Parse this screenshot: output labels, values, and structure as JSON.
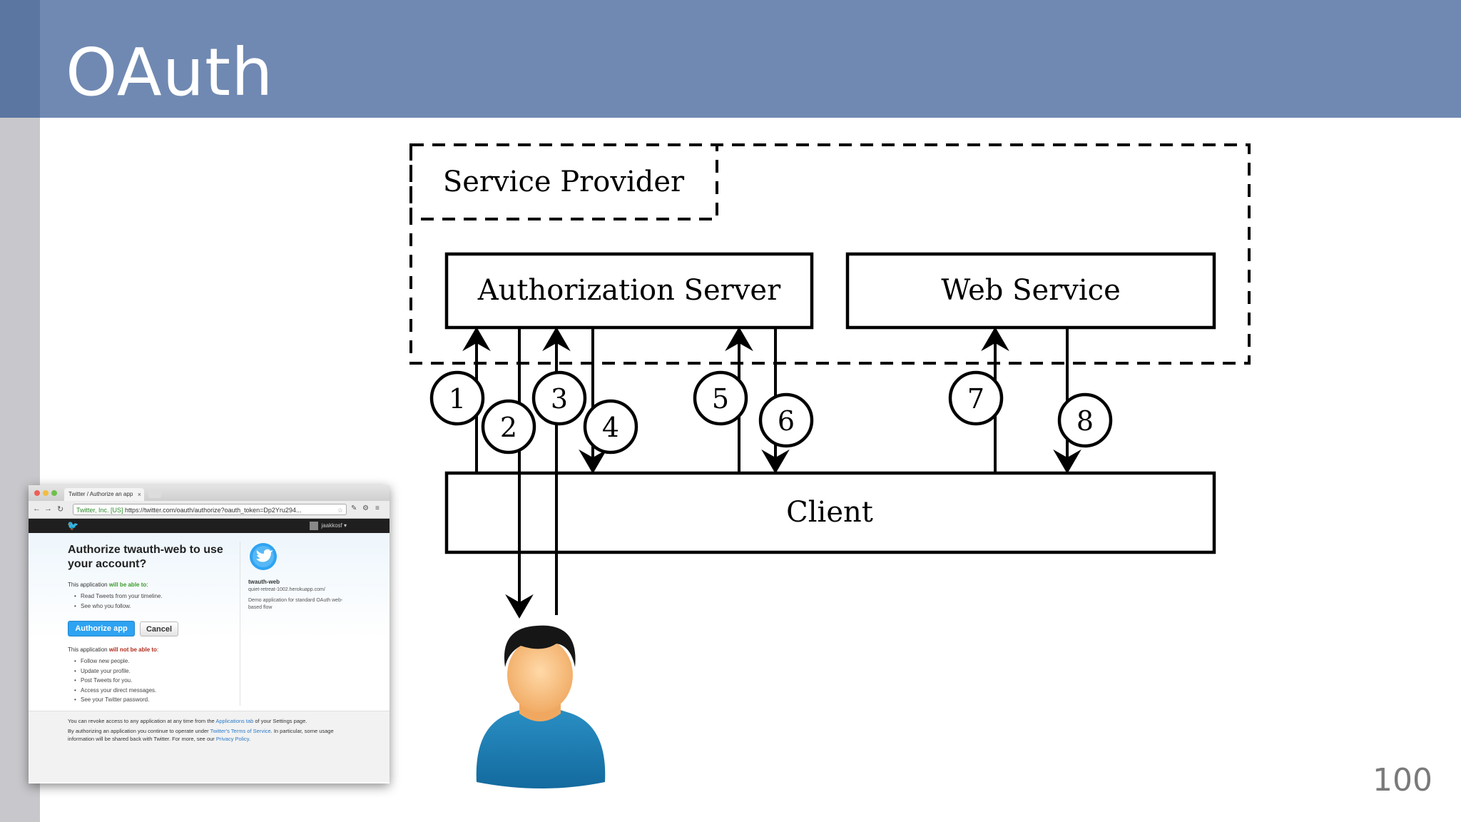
{
  "slide": {
    "title": "OAuth",
    "page_number": "100",
    "colors": {
      "header": "#7089b2",
      "left_bar": "#c8c8cc",
      "left_bar_top": "#5c76a2"
    }
  },
  "diagram": {
    "service_provider_label": "Service Provider",
    "authorization_server_label": "Authorization Server",
    "web_service_label": "Web Service",
    "client_label": "Client",
    "steps": [
      "1",
      "2",
      "3",
      "4",
      "5",
      "6",
      "7",
      "8"
    ]
  },
  "browser": {
    "tab_title": "Twitter / Authorize an app",
    "tab_close": "×",
    "secure_label": "Twitter, Inc. [US]",
    "url": "https://twitter.com/oauth/authorize?oauth_token=Dp2Yru294...",
    "username": "jaakkosf ▾",
    "heading": "Authorize twauth-web to use your account?",
    "able_intro_prefix": "This application ",
    "able_intro_emph": "will be able to",
    "able_intro_suffix": ":",
    "able_items": [
      "Read Tweets from your timeline.",
      "See who you follow."
    ],
    "authorize_button": "Authorize app",
    "cancel_button": "Cancel",
    "not_able_intro_prefix": "This application ",
    "not_able_intro_emph": "will not be able to",
    "not_able_intro_suffix": ":",
    "not_able_items": [
      "Follow new people.",
      "Update your profile.",
      "Post Tweets for you.",
      "Access your direct messages.",
      "See your Twitter password."
    ],
    "app_name": "twauth-web",
    "app_url": "quiet-retreat-1002.herokuapp.com/",
    "app_desc": "Demo application for standard OAuth web-based flow",
    "footer_1a": "You can revoke access to any application at any time from the ",
    "footer_1_link": "Applications tab",
    "footer_1b": " of your Settings page.",
    "footer_2a": "By authorizing an application you continue to operate under ",
    "footer_2_link": "Twitter's Terms of Service",
    "footer_2b": ". In particular, some usage information will be shared back with Twitter. For more, see our ",
    "footer_2_link2": "Privacy Policy",
    "footer_2c": "."
  }
}
